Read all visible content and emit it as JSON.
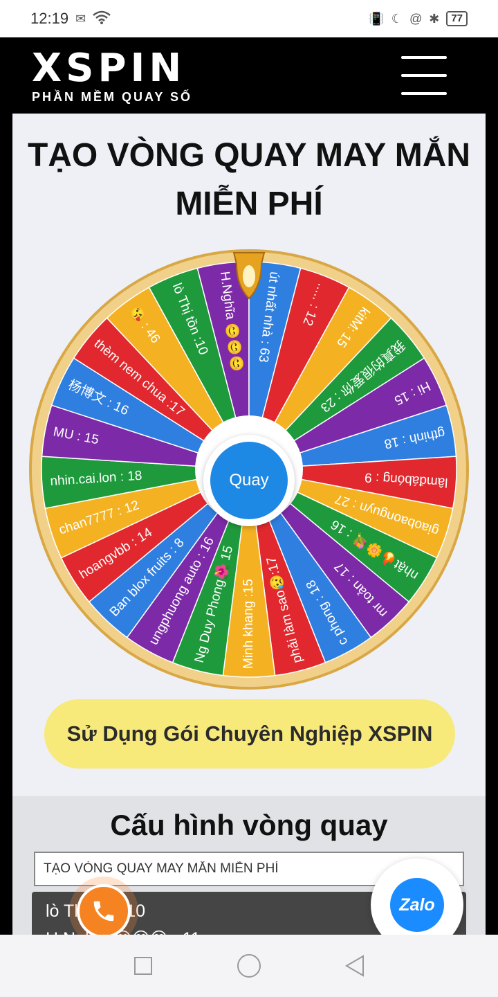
{
  "status_bar": {
    "time": "12:19",
    "battery": "77"
  },
  "header": {
    "logo_main": "XSPIN",
    "logo_sub": "PHẦN MỀM QUAY SỐ"
  },
  "page": {
    "title": "TẠO VÒNG QUAY MAY MẮN MIỄN PHÍ"
  },
  "wheel": {
    "spin_label": "Quay",
    "segments": [
      {
        "label": "lò Thị tồn :10",
        "color": "#1e9a3c"
      },
      {
        "label": "H.Nghĩa 😊😊😊",
        "color": "#7d2aa8"
      },
      {
        "label": "út nhất nhà : 63",
        "color": "#2f7fe0"
      },
      {
        "label": "..... : 12",
        "color": "#e0282e"
      },
      {
        "label": "kitM: 15",
        "color": "#f4b223"
      },
      {
        "label": "我真的很爱你 : 23",
        "color": "#1e9a3c"
      },
      {
        "label": "Hi : 15",
        "color": "#7d2aa8"
      },
      {
        "label": "gthinh : 18",
        "color": "#2f7fe0"
      },
      {
        "label": "lâmđábóng : 9",
        "color": "#e0282e"
      },
      {
        "label": "giaobaonguyn : 27",
        "color": "#f4b223"
      },
      {
        "label": "nhật🔥🌼💐 : 16",
        "color": "#1e9a3c"
      },
      {
        "label": "mr toản : 17",
        "color": "#7d2aa8"
      },
      {
        "label": "c phong : 18",
        "color": "#2f7fe0"
      },
      {
        "label": "phải làm sao😥:17",
        "color": "#e0282e"
      },
      {
        "label": "Minh khang :15",
        "color": "#f4b223"
      },
      {
        "label": "Ng Duy Phong🌺 15",
        "color": "#1e9a3c"
      },
      {
        "label": "ungphuong auto : 16",
        "color": "#7d2aa8"
      },
      {
        "label": "Ban blox fruits : 8",
        "color": "#2f7fe0"
      },
      {
        "label": "hoangvbb : 14",
        "color": "#e0282e"
      },
      {
        "label": "chan7777 : 12",
        "color": "#f4b223"
      },
      {
        "label": "nhin.cai.lon : 18",
        "color": "#1e9a3c"
      },
      {
        "label": "MU : 15",
        "color": "#7d2aa8"
      },
      {
        "label": "杨博文 : 16",
        "color": "#2f7fe0"
      },
      {
        "label": "thèm nem chua :17",
        "color": "#e0282e"
      },
      {
        "label": "😘 : 46",
        "color": "#f4b223"
      }
    ]
  },
  "pro_button": {
    "label": "Sử Dụng Gói Chuyên Nghiệp XSPIN"
  },
  "config": {
    "title": "Cấu hình vòng quay",
    "title_value": "TẠO VÒNG QUAY MAY MẮN MIỄN PHÍ",
    "entries": [
      "lò Thị tồn :10",
      "H.Nghĩa 😊😊😊 : 11"
    ]
  },
  "fabs": {
    "zalo_label": "Zalo"
  }
}
